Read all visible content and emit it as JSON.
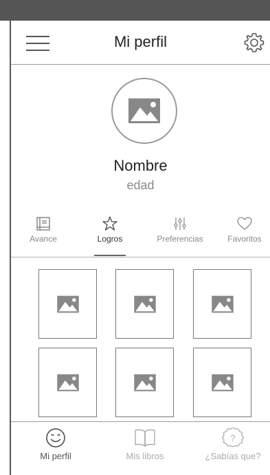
{
  "header": {
    "title": "Mi perfil",
    "menu_icon": "hamburger-menu-icon",
    "settings_icon": "gear-icon"
  },
  "profile": {
    "avatar_icon": "image-placeholder-icon",
    "name": "Nombre",
    "age": "edad"
  },
  "tabs": [
    {
      "label": "Avance",
      "icon": "progress-icon",
      "active": false
    },
    {
      "label": "Logros",
      "icon": "star-icon",
      "active": true
    },
    {
      "label": "Preferencias",
      "icon": "sliders-icon",
      "active": false
    },
    {
      "label": "Favoritos",
      "icon": "heart-icon",
      "active": false
    }
  ],
  "grid": {
    "tile_icon": "image-placeholder-icon",
    "tile_count": 6
  },
  "bottom_nav": [
    {
      "label": "Mi perfil",
      "icon": "smiley-icon",
      "active": true
    },
    {
      "label": "Mis libros",
      "icon": "book-icon",
      "active": false
    },
    {
      "label": "¿Sabías que?",
      "icon": "question-badge-icon",
      "active": false
    }
  ],
  "colors": {
    "status_bar": "#555555",
    "border": "#9a9a9a",
    "text_dark": "#222222",
    "text_muted": "#888888"
  }
}
